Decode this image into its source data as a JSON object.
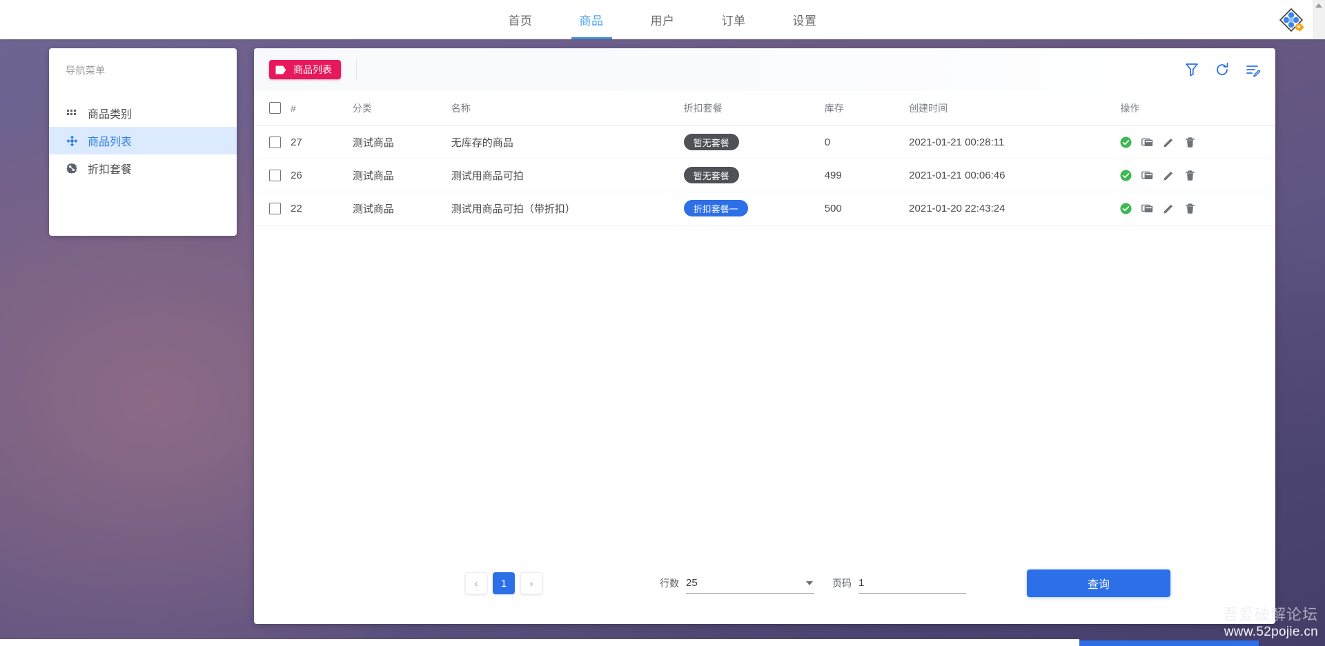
{
  "topnav": {
    "items": [
      {
        "label": "首页",
        "active": false
      },
      {
        "label": "商品",
        "active": true
      },
      {
        "label": "用户",
        "active": false
      },
      {
        "label": "订单",
        "active": false
      },
      {
        "label": "设置",
        "active": false
      }
    ],
    "logo_icon": "app-logo-icon",
    "scroll_icon": "scroll-up-icon"
  },
  "sidebar": {
    "title": "导航菜单",
    "items": [
      {
        "label": "商品类别",
        "icon": "grid-icon",
        "active": false
      },
      {
        "label": "商品列表",
        "icon": "diamond-cluster-icon",
        "active": true
      },
      {
        "label": "折扣套餐",
        "icon": "gear-percent-icon",
        "active": false
      }
    ]
  },
  "toolbar": {
    "chip_label": "商品列表",
    "chip_icon": "tag-icon",
    "chip_color": "#e8185d",
    "actions": [
      {
        "name": "filter-icon",
        "title": "筛选"
      },
      {
        "name": "refresh-icon",
        "title": "刷新"
      },
      {
        "name": "edit-list-icon",
        "title": "编辑列"
      }
    ],
    "action_color": "#2d6fe8"
  },
  "table": {
    "columns": [
      "",
      "#",
      "分类",
      "名称",
      "折扣套餐",
      "库存",
      "创建时间",
      "操作"
    ],
    "rows": [
      {
        "id": "27",
        "category": "测试商品",
        "name": "无库存的商品",
        "package": "暂无套餐",
        "package_type": "none",
        "stock": "0",
        "created": "2021-01-21 00:28:11"
      },
      {
        "id": "26",
        "category": "测试商品",
        "name": "测试用商品可拍",
        "package": "暂无套餐",
        "package_type": "none",
        "stock": "499",
        "created": "2021-01-21 00:06:46"
      },
      {
        "id": "22",
        "category": "测试商品",
        "name": "测试用商品可拍（带折扣）",
        "package": "折扣套餐一",
        "package_type": "pkg",
        "stock": "500",
        "created": "2021-01-20 22:43:24"
      }
    ],
    "row_actions": [
      {
        "name": "status-check-icon",
        "color": "#3cb852"
      },
      {
        "name": "copy-card-icon",
        "color": "#6e7279"
      },
      {
        "name": "edit-pencil-icon",
        "color": "#6e7279"
      },
      {
        "name": "delete-trash-icon",
        "color": "#6e7279"
      }
    ],
    "badge_colors": {
      "none": "#4e5257",
      "pkg": "#2d6fe8"
    }
  },
  "pagination": {
    "prev_icon": "chevron-left-icon",
    "next_icon": "chevron-right-icon",
    "current_page": "1",
    "rows_label": "行数",
    "rows_value": "25",
    "rows_placeholder": "25",
    "page_label": "页码",
    "page_value": "1",
    "page_placeholder": "1",
    "query_label": "查询",
    "query_color": "#2d6fe8",
    "dropdown_icon": "caret-down-icon"
  },
  "watermark": {
    "line1": "吾爱破解论坛",
    "line2": "www.52pojie.cn"
  }
}
